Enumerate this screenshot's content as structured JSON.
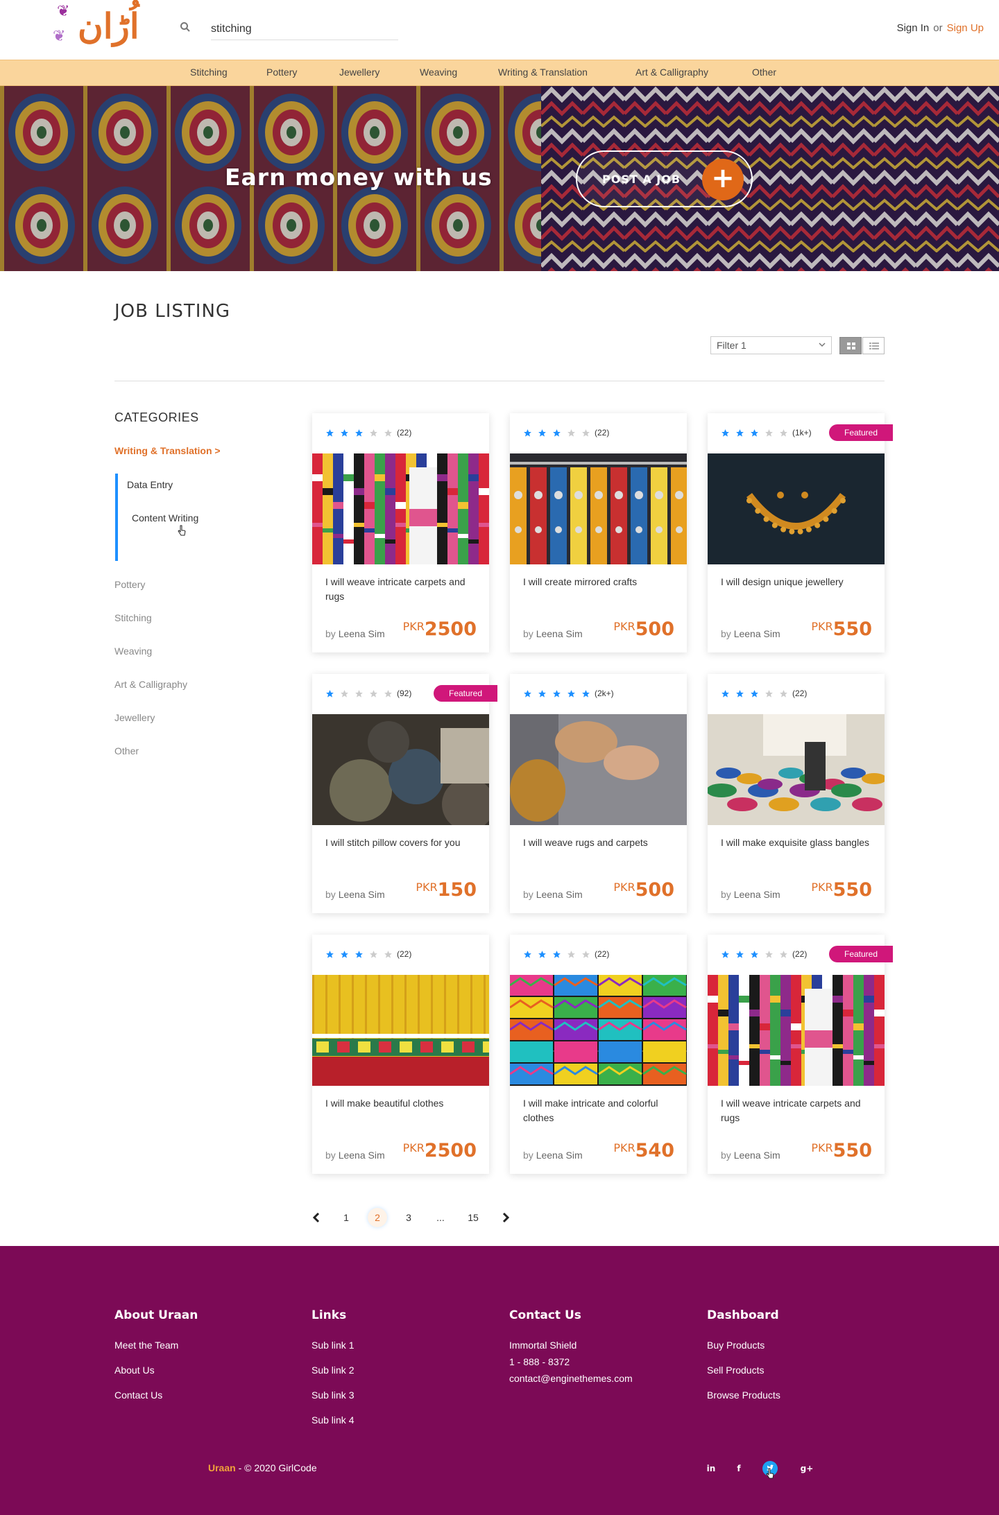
{
  "header": {
    "logo_text": "اُڑان",
    "search_value": "stitching",
    "sign_in": "Sign In",
    "or": "or",
    "sign_up": "Sign Up"
  },
  "nav": [
    "Stitching",
    "Pottery",
    "Jewellery",
    "Weaving",
    "Writing & Translation",
    "Art & Calligraphy",
    "Other"
  ],
  "hero": {
    "title": "Earn money with us",
    "button_label": "POST A JOB",
    "button_icon": "plus-icon"
  },
  "listing": {
    "title": "JOB LISTING",
    "filter_value": "Filter 1",
    "view_modes": [
      "grid-view-icon",
      "list-view-icon"
    ]
  },
  "sidebar": {
    "title": "CATEGORIES",
    "active": "Writing & Translation >",
    "subcategories": [
      "Data Entry",
      "Content Writing"
    ],
    "categories": [
      "Pottery",
      "Stitching",
      "Weaving",
      "Art & Calligraphy",
      "Jewellery",
      "Other"
    ]
  },
  "cards": [
    {
      "rating": 3,
      "count": "(22)",
      "featured": false,
      "title": "I will weave intricate carpets and rugs",
      "by": "by",
      "author": "Leena Sim",
      "currency": "PKR",
      "price": "2500",
      "image": "woven-textiles"
    },
    {
      "rating": 3,
      "count": "(22)",
      "featured": false,
      "title": "I will create mirrored crafts",
      "by": "by",
      "author": "Leena Sim",
      "currency": "PKR",
      "price": "500",
      "image": "mirrored-crafts"
    },
    {
      "rating": 3,
      "count": "(1k+)",
      "featured": true,
      "featured_label": "Featured",
      "title": "I will design unique jewellery",
      "by": "by",
      "author": "Leena Sim",
      "currency": "PKR",
      "price": "550",
      "image": "gold-necklace"
    },
    {
      "rating": 1,
      "count": "(92)",
      "featured": true,
      "featured_label": "Featured",
      "title": "I will stitch pillow covers for you",
      "by": "by",
      "author": "Leena Sim",
      "currency": "PKR",
      "price": "150",
      "image": "yarn-spools"
    },
    {
      "rating": 5,
      "count": "(2k+)",
      "featured": false,
      "title": "I will weave rugs and carpets",
      "by": "by",
      "author": "Leena Sim",
      "currency": "PKR",
      "price": "500",
      "image": "knitting-hands"
    },
    {
      "rating": 3,
      "count": "(22)",
      "featured": false,
      "title": "I will make exquisite glass bangles",
      "by": "by",
      "author": "Leena Sim",
      "currency": "PKR",
      "price": "550",
      "image": "glass-bangles"
    },
    {
      "rating": 3,
      "count": "(22)",
      "featured": false,
      "title": "I will make beautiful clothes",
      "by": "by",
      "author": "Leena Sim",
      "currency": "PKR",
      "price": "2500",
      "image": "embroidered-skirts"
    },
    {
      "rating": 3,
      "count": "(22)",
      "featured": false,
      "title": "I will make intricate and colorful clothes",
      "by": "by",
      "author": "Leena Sim",
      "currency": "PKR",
      "price": "540",
      "image": "colorful-fabrics"
    },
    {
      "rating": 3,
      "count": "(22)",
      "featured": true,
      "featured_label": "Featured",
      "title": "I will weave intricate carpets and rugs",
      "by": "by",
      "author": "Leena Sim",
      "currency": "PKR",
      "price": "550",
      "image": "woven-textiles"
    }
  ],
  "pagination": {
    "pages": [
      "1",
      "2",
      "3",
      "...",
      "15"
    ],
    "current": "2"
  },
  "colors": {
    "accent": "#e0712a",
    "nav_bg": "#fad59c",
    "footer_bg": "#7c0a56",
    "featured": "#d0177a",
    "star": "#1e90ff"
  },
  "footer": {
    "columns": [
      {
        "title": "About Uraan",
        "links": [
          "Meet the Team",
          "About Us",
          "Contact Us"
        ]
      },
      {
        "title": "Links",
        "links": [
          "Sub link 1",
          "Sub link 2",
          "Sub link 3",
          "Sub link 4"
        ]
      },
      {
        "title": "Contact Us",
        "links": [
          "Immortal Shield",
          "1 - 888 - 8372",
          "contact@enginethemes.com"
        ]
      },
      {
        "title": "Dashboard",
        "links": [
          "Buy Products",
          "Sell Products",
          "Browse Products"
        ]
      }
    ],
    "brand": "Uraan",
    "copyright": " - © 2020 GirlCode",
    "social": [
      "linkedin-icon",
      "facebook-icon",
      "twitter-icon",
      "google-plus-icon"
    ]
  }
}
